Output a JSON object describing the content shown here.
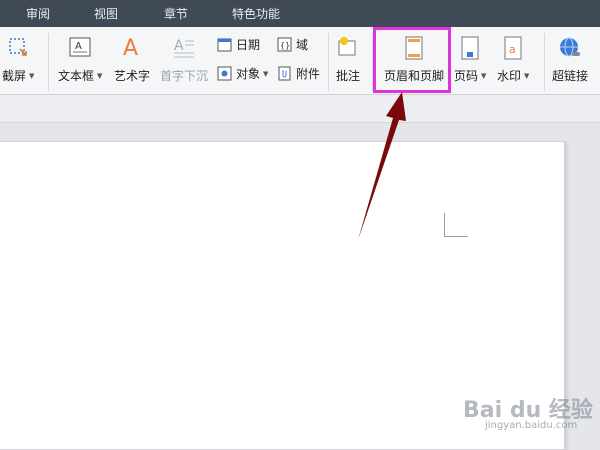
{
  "menubar": {
    "tabs": [
      "审阅",
      "视图",
      "章节",
      "特色功能"
    ]
  },
  "ribbon": {
    "screenshot_label": "截屏",
    "textbox_label": "文本框",
    "wordart_label": "艺术字",
    "dropcap_label": "首字下沉",
    "date_label": "日期",
    "field_label": "域",
    "object_label": "对象",
    "attachment_label": "附件",
    "comment_label": "批注",
    "header_footer_label": "页眉和页脚",
    "page_number_label": "页码",
    "watermark_label": "水印",
    "hyperlink_label": "超链接"
  },
  "watermark": {
    "logo": "Bai du 经验",
    "site": "jingyan.baidu.com"
  },
  "colors": {
    "menubar_bg": "#3f4a56",
    "highlight": "#e033d9",
    "arrow": "#7a0a0a"
  }
}
